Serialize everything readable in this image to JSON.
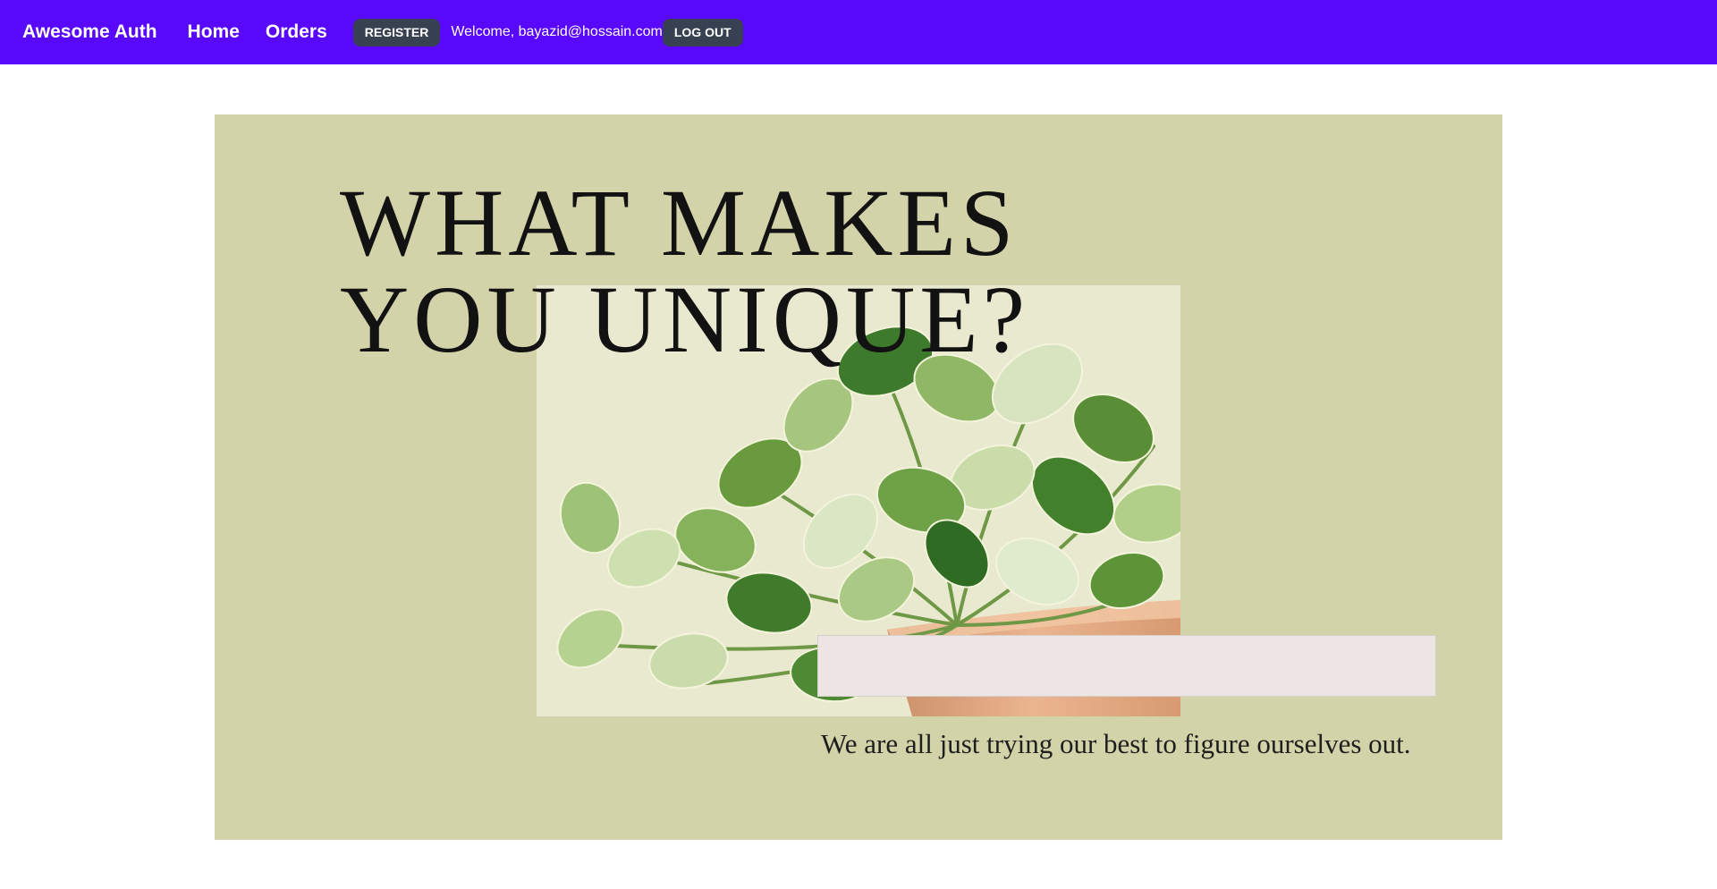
{
  "colors": {
    "nav_bg": "#5808fb",
    "button_bg": "#374151",
    "hero_bg": "#d3d3aa",
    "caption_box_bg": "#ece5e3"
  },
  "nav": {
    "brand": "Awesome Auth",
    "links": [
      "Home",
      "Orders"
    ],
    "register_label": "REGISTER",
    "welcome_text": "Welcome, bayazid@hossain.com",
    "logout_label": "LOG OUT"
  },
  "hero": {
    "headline_line1": "WHAT MAKES",
    "headline_line2": "YOU UNIQUE?",
    "image": "pothos-plant-photo",
    "tagline": "We are all just trying our best to figure ourselves out."
  }
}
